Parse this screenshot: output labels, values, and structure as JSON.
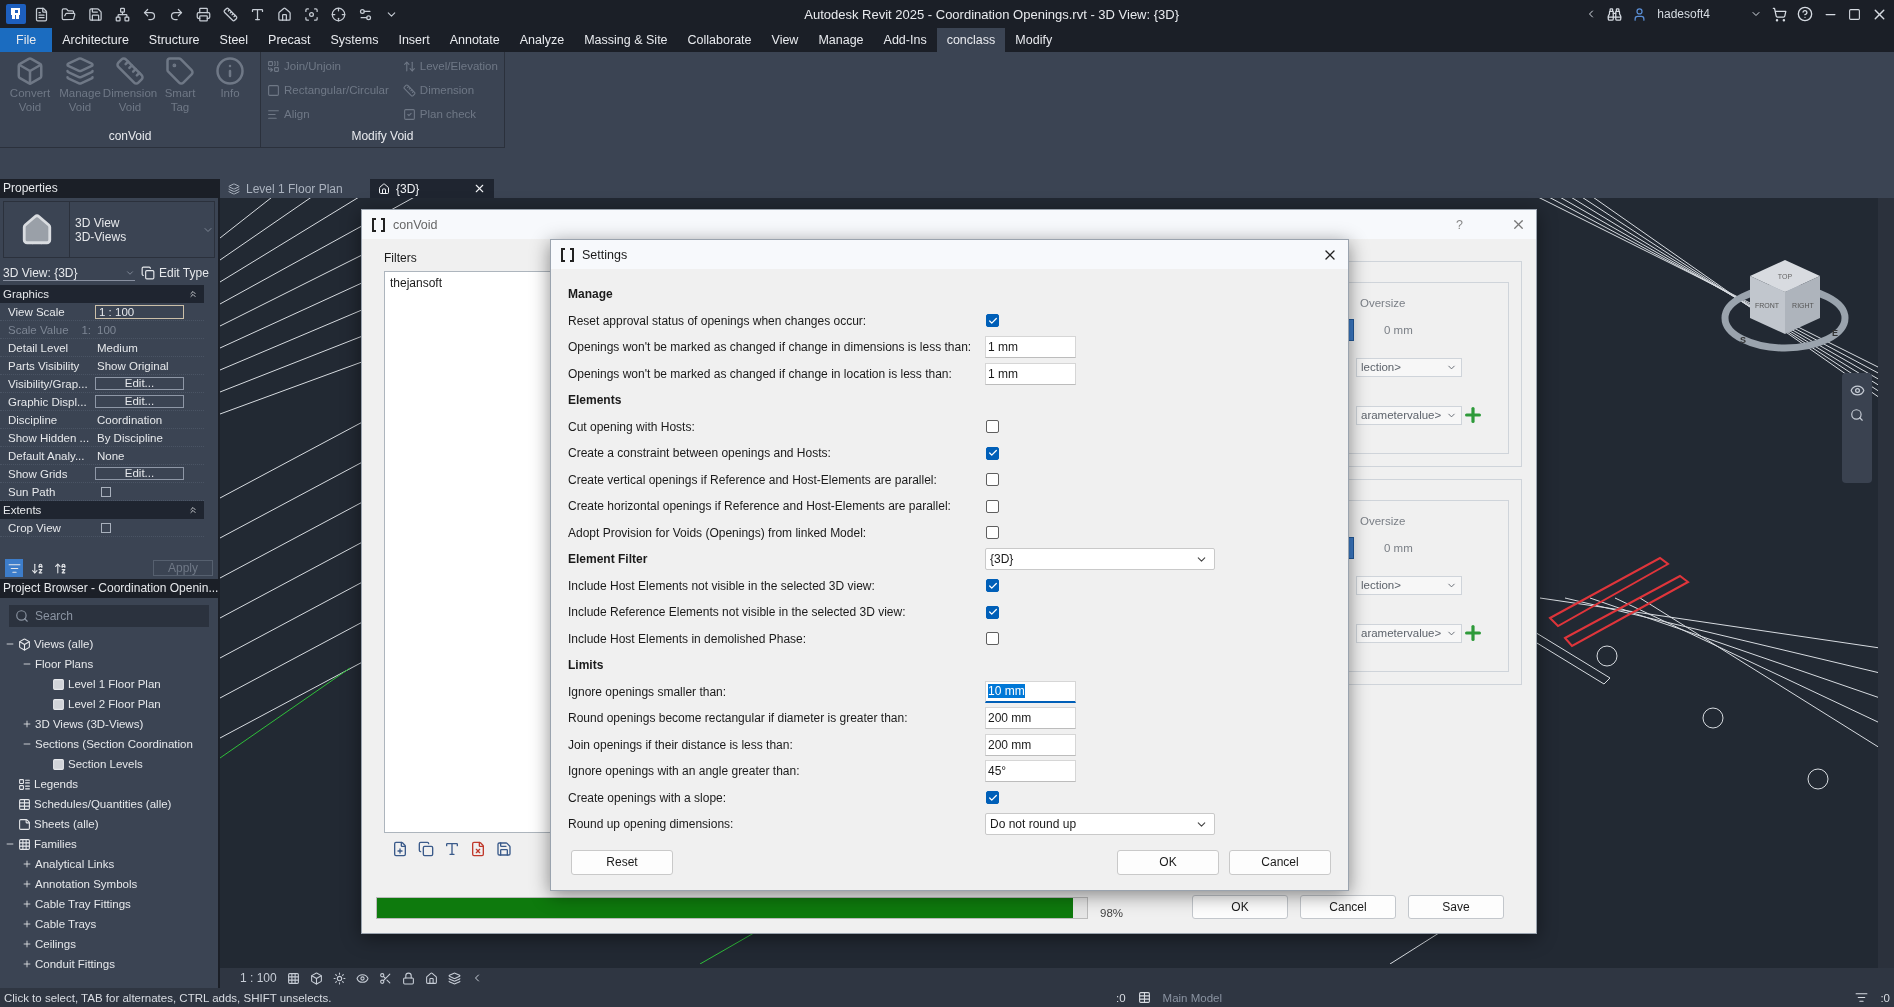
{
  "window": {
    "title": "Autodesk Revit 2025 - Coordination Openings.rvt - 3D View: {3D}",
    "user": "hadesoft4"
  },
  "menu_tabs": [
    {
      "label": "File",
      "kind": "file",
      "selected": false
    },
    {
      "label": "Architecture",
      "kind": "tab",
      "selected": false
    },
    {
      "label": "Structure",
      "kind": "tab",
      "selected": false
    },
    {
      "label": "Steel",
      "kind": "tab",
      "selected": false
    },
    {
      "label": "Precast",
      "kind": "tab",
      "selected": false
    },
    {
      "label": "Systems",
      "kind": "tab",
      "selected": false
    },
    {
      "label": "Insert",
      "kind": "tab",
      "selected": false
    },
    {
      "label": "Annotate",
      "kind": "tab",
      "selected": false
    },
    {
      "label": "Analyze",
      "kind": "tab",
      "selected": false
    },
    {
      "label": "Massing & Site",
      "kind": "tab",
      "selected": false
    },
    {
      "label": "Collaborate",
      "kind": "tab",
      "selected": false
    },
    {
      "label": "View",
      "kind": "tab",
      "selected": false
    },
    {
      "label": "Manage",
      "kind": "tab",
      "selected": false
    },
    {
      "label": "Add-Ins",
      "kind": "tab",
      "selected": false
    },
    {
      "label": "conclass",
      "kind": "tab",
      "selected": true
    },
    {
      "label": "Modify",
      "kind": "tab",
      "selected": false
    }
  ],
  "ribbon": [
    {
      "title": "conVoid",
      "kind": "large",
      "buttons": [
        {
          "label": "Convert Void",
          "disabled": true
        },
        {
          "label": "Manage Void",
          "disabled": true
        },
        {
          "label": "Dimension Void",
          "disabled": true
        },
        {
          "label": "Smart Tag",
          "disabled": true
        },
        {
          "label": "Info",
          "disabled": true
        }
      ]
    },
    {
      "title": "Modify Void",
      "kind": "small",
      "buttons": [
        {
          "label": "Join/Unjoin",
          "disabled": true
        },
        {
          "label": "Rectangular/Circular",
          "disabled": true
        },
        {
          "label": "Align",
          "disabled": true
        },
        {
          "label": "Level/Elevation",
          "disabled": true
        },
        {
          "label": "Dimension",
          "disabled": true
        },
        {
          "label": "Plan check",
          "disabled": true
        }
      ]
    }
  ],
  "view_tabs": [
    {
      "label": "Level 1 Floor Plan",
      "selected": false
    },
    {
      "label": "{3D}",
      "selected": true
    }
  ],
  "properties": {
    "title": "Properties",
    "type_name": "3D View",
    "type_family": "3D-Views",
    "instance": "3D View: {3D}",
    "edit_type": "Edit Type",
    "groups": [
      {
        "title": "Graphics",
        "rows": [
          {
            "label": "View Scale",
            "kind": "field",
            "value": "1 : 100"
          },
          {
            "label": "Scale Value",
            "unit": "1:",
            "kind": "readonly",
            "value": "100"
          },
          {
            "label": "Detail Level",
            "kind": "text",
            "value": "Medium"
          },
          {
            "label": "Parts Visibility",
            "kind": "text",
            "value": "Show Original"
          },
          {
            "label": "Visibility/Grap...",
            "kind": "button",
            "value": "Edit..."
          },
          {
            "label": "Graphic Displ...",
            "kind": "button",
            "value": "Edit..."
          },
          {
            "label": "Discipline",
            "kind": "text",
            "value": "Coordination"
          },
          {
            "label": "Show Hidden ...",
            "kind": "text",
            "value": "By Discipline"
          },
          {
            "label": "Default Analy...",
            "kind": "text",
            "value": "None"
          },
          {
            "label": "Show Grids",
            "kind": "button",
            "value": "Edit..."
          },
          {
            "label": "Sun Path",
            "kind": "checkbox",
            "checked": false
          }
        ]
      },
      {
        "title": "Extents",
        "rows": [
          {
            "label": "Crop View",
            "kind": "checkbox",
            "checked": false
          }
        ]
      }
    ],
    "apply": {
      "label": "Apply",
      "disabled": true
    }
  },
  "project_browser": {
    "title": "Project Browser - Coordination Openin...",
    "search_placeholder": "Search",
    "tree": [
      {
        "label": "Views (alle)",
        "kind": "views",
        "expanded": true,
        "children": [
          {
            "label": "Floor Plans",
            "expanded": true,
            "children": [
              {
                "label": "Level 1 Floor Plan",
                "kind": "view"
              },
              {
                "label": "Level 2 Floor Plan",
                "kind": "view"
              }
            ]
          },
          {
            "label": "3D Views (3D-Views)",
            "expanded": false
          },
          {
            "label": "Sections (Section Coordination",
            "expanded": true,
            "children": [
              {
                "label": "Section Levels",
                "kind": "view"
              }
            ]
          }
        ]
      },
      {
        "label": "Legends",
        "kind": "legend"
      },
      {
        "label": "Schedules/Quantities (alle)",
        "kind": "schedule"
      },
      {
        "label": "Sheets (alle)",
        "kind": "sheet"
      },
      {
        "label": "Families",
        "kind": "family",
        "expanded": true,
        "children": [
          {
            "label": "Analytical Links",
            "expanded": false
          },
          {
            "label": "Annotation Symbols",
            "expanded": false
          },
          {
            "label": "Cable Tray Fittings",
            "expanded": false
          },
          {
            "label": "Cable Trays",
            "expanded": false
          },
          {
            "label": "Ceilings",
            "expanded": false
          },
          {
            "label": "Conduit Fittings",
            "expanded": false
          }
        ]
      }
    ]
  },
  "viewcube": {
    "top": "TOP",
    "front": "FRONT",
    "right": "RIGHT",
    "compass": [
      "S",
      "E"
    ]
  },
  "view_bar": {
    "scale": "1 : 100"
  },
  "status_bar": {
    "message": "Click to select, TAB for alternates, CTRL adds, SHIFT unselects.",
    "worksets": ":0",
    "model": "Main Model",
    "filters": ":0"
  },
  "convoid": {
    "title": "conVoid",
    "help": "?",
    "filters_label": "Filters",
    "filters": [
      {
        "label": "thejansoft",
        "selected": false
      }
    ],
    "groups": [
      {
        "oversize_label": "Oversize",
        "oversize": "0 mm",
        "selection": "lection>",
        "parameter": "arametervalue>"
      },
      {
        "oversize_label": "Oversize",
        "oversize": "0 mm",
        "selection": "lection>",
        "parameter": "arametervalue>"
      }
    ],
    "progress": {
      "level": 0.98,
      "reading": "98%"
    },
    "buttons": [
      "OK",
      "Cancel",
      "Save"
    ]
  },
  "settings": {
    "title": "Settings",
    "sections": [
      {
        "title": "Manage",
        "rows": [
          {
            "kind": "checkbox",
            "label": "Reset approval status of openings when changes occur:",
            "checked": true
          },
          {
            "kind": "input",
            "label": "Openings won't be marked as changed if change in dimensions is less than:",
            "value": "1 mm",
            "focused": false
          },
          {
            "kind": "input",
            "label": "Openings won't be marked as changed if change in location is less than:",
            "value": "1 mm",
            "focused": false
          }
        ]
      },
      {
        "title": "Elements",
        "rows": [
          {
            "kind": "checkbox",
            "label": "Cut opening with Hosts:",
            "checked": false
          },
          {
            "kind": "checkbox",
            "label": "Create a constraint between openings and Hosts:",
            "checked": true
          },
          {
            "kind": "checkbox",
            "label": "Create vertical openings if Reference and Host-Elements are parallel:",
            "checked": false
          },
          {
            "kind": "checkbox",
            "label": "Create horizontal openings if Reference and Host-Elements are parallel:",
            "checked": false
          },
          {
            "kind": "checkbox",
            "label": "Adopt Provision for Voids (Openings) from linked Model:",
            "checked": false
          }
        ]
      },
      {
        "title": "Element Filter",
        "select": "{3D}",
        "rows": [
          {
            "kind": "checkbox",
            "label": "Include Host Elements not visible in the selected 3D view:",
            "checked": true
          },
          {
            "kind": "checkbox",
            "label": "Include Reference Elements not visible in the selected 3D view:",
            "checked": true
          },
          {
            "kind": "checkbox",
            "label": "Include Host Elements in demolished Phase:",
            "checked": false
          }
        ]
      },
      {
        "title": "Limits",
        "rows": [
          {
            "kind": "input",
            "label": "Ignore openings smaller than:",
            "value": "10 mm",
            "focused": true
          },
          {
            "kind": "input",
            "label": "Round openings become rectangular if diameter is greater than:",
            "value": "200 mm",
            "focused": false
          },
          {
            "kind": "input",
            "label": "Join openings if their distance is less than:",
            "value": "200 mm",
            "focused": false
          },
          {
            "kind": "input",
            "label": "Ignore openings with an angle greater than:",
            "value": "45°",
            "focused": false
          },
          {
            "kind": "checkbox",
            "label": "Create openings with a slope:",
            "checked": true
          },
          {
            "kind": "select",
            "label": "Round up opening dimensions:",
            "value": "Do not round up"
          }
        ]
      }
    ],
    "reset": "Reset",
    "ok": "OK",
    "cancel": "Cancel"
  }
}
